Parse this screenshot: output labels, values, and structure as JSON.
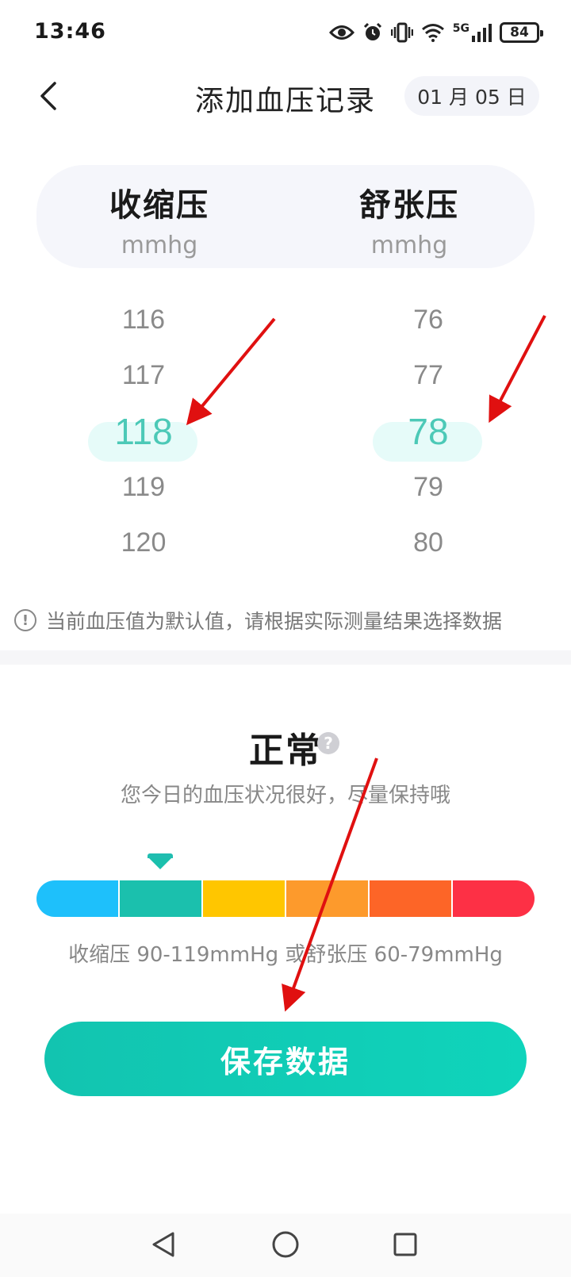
{
  "status_bar": {
    "time": "13:46",
    "network": "5G",
    "battery": "84",
    "icons": [
      "eye-icon",
      "alarm-icon",
      "vibrate-icon",
      "wifi-icon",
      "signal-icon",
      "battery-icon"
    ]
  },
  "header": {
    "back_icon": "chevron-left-icon",
    "title": "添加血压记录",
    "date": "01 月 05 日"
  },
  "labels": {
    "systolic": "收缩压",
    "systolic_unit": "mmhg",
    "diastolic": "舒张压",
    "diastolic_unit": "mmhg"
  },
  "picker": {
    "systolic": [
      "116",
      "117",
      "118",
      "119",
      "120"
    ],
    "diastolic": [
      "76",
      "77",
      "78",
      "79",
      "80"
    ],
    "selected_index": 2,
    "selected_color": "#4cc9b7"
  },
  "hint": {
    "icon": "info-icon",
    "text": "当前血压值为默认值，请根据实际测量结果选择数据"
  },
  "result": {
    "state": "正常",
    "help_icon": "question-icon",
    "help_glyph": "?",
    "description": "您今日的血压状况很好，尽量保持哦",
    "range": "收缩压 90-119mmHg 或舒张压 60-79mmHg"
  },
  "scale": {
    "segment_colors": [
      "#1ec0fb",
      "#1bc0ad",
      "#ffc600",
      "#fd9a2c",
      "#fd6527",
      "#fd3045"
    ],
    "current_level_index": 1
  },
  "save_button": {
    "label": "保存数据"
  },
  "nav_bar": {
    "icons": [
      "back-triangle-icon",
      "home-circle-icon",
      "recents-square-icon"
    ]
  },
  "annotation_color": "#e01010"
}
